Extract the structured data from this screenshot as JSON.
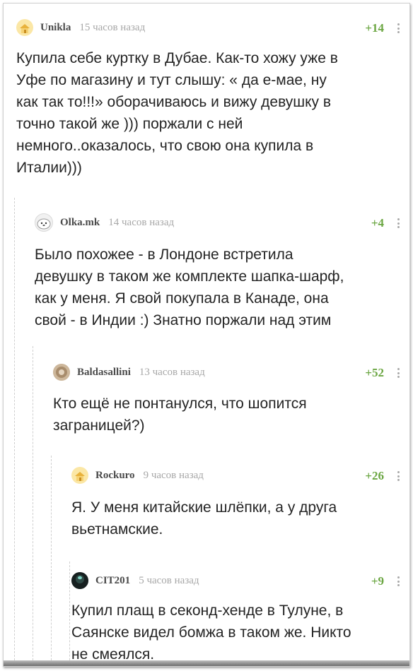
{
  "comments": [
    {
      "author": "Unikla",
      "time": "15 часов назад",
      "rating": "+14",
      "avatar_icon": "house-icon",
      "text": "Купила себе куртку в Дубае. Как-то хожу уже в\nУфе по магазину и тут слышу: « да е-мае, ну\nкак так то!!!» оборачиваюсь и вижу девушку в\nточно такой же ))) поржали с ней\nнемного..оказалось, что свою она купила в\nИталии)))"
    },
    {
      "author": "Olka.mk",
      "time": "14 часов назад",
      "rating": "+4",
      "avatar_icon": "seal-icon",
      "text": "Было похожее - в Лондоне встретила\nдевушку в таком же комплекте шапка-шарф,\nкак у меня. Я свой покупала в Канаде, она\nсвой - в Индии :) Знатно поржали над этим"
    },
    {
      "author": "Baldasallini",
      "time": "13 часов назад",
      "rating": "+52",
      "avatar_icon": "round-photo-icon",
      "text": "Кто ещё не понтанулся, что шопится\nзаграницей?)"
    },
    {
      "author": "Rockuro",
      "time": "9 часов назад",
      "rating": "+26",
      "avatar_icon": "house-icon",
      "text": "Я. У меня китайские шлёпки, а у друга\nвьетнамские."
    },
    {
      "author": "CIT201",
      "time": "5 часов назад",
      "rating": "+9",
      "avatar_icon": "dark-sphere-icon",
      "text": "Купил плащ в секонд-хенде в Тулуне, в\nСаянске видел бомжа в таком же. Никто\nне смеялся."
    }
  ],
  "colors": {
    "rating": "#6ba642",
    "author": "#4a4a4a",
    "time": "#a7a7a7",
    "thread_line": "#cfcfcf"
  }
}
